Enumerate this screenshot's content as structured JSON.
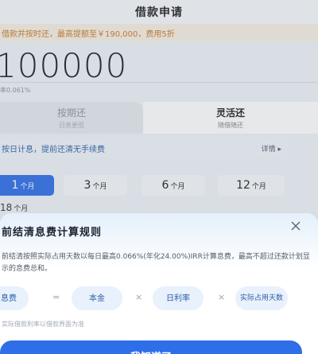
{
  "header": {
    "title": "借款申请"
  },
  "promo": {
    "text": "借款并按时还，最高提额至￥190,000，费用5折"
  },
  "loan": {
    "amount": "100000",
    "rate_note": "率0.061%"
  },
  "repay_modes": [
    {
      "label": "按期还",
      "sub": "日息更低"
    },
    {
      "label": "灵活还",
      "sub": "随借随还"
    }
  ],
  "info": {
    "text": "按日计息，提前还清无手续费",
    "detail_label": "详情 ▸"
  },
  "terms": [
    {
      "num": "1",
      "unit": "个月"
    },
    {
      "num": "3",
      "unit": "个月"
    },
    {
      "num": "6",
      "unit": "个月"
    },
    {
      "num": "12",
      "unit": "个月"
    }
  ],
  "term_selected": {
    "num": "18",
    "unit": "个月"
  },
  "sheet": {
    "title": "前结清息费计算规则",
    "desc": "前结清按照实际占用天数以每日最高0.066%(年化24.00%)IRR计算息费，最高不超过还款计划显示的息费总和。",
    "formula": {
      "item1": "息费",
      "eq": "=",
      "item2": "本金",
      "mul1": "×",
      "item3": "日利率",
      "mul2": "×",
      "item4": "实际占用天数"
    },
    "footnote": "实际借款利率以借款界面为准",
    "confirm_label": "我知道了"
  },
  "colors": {
    "accent": "#2e6ee8",
    "promo_text": "#c8792b",
    "formula_text": "#2b5fa8"
  },
  "icons": {
    "close": "close-icon"
  }
}
